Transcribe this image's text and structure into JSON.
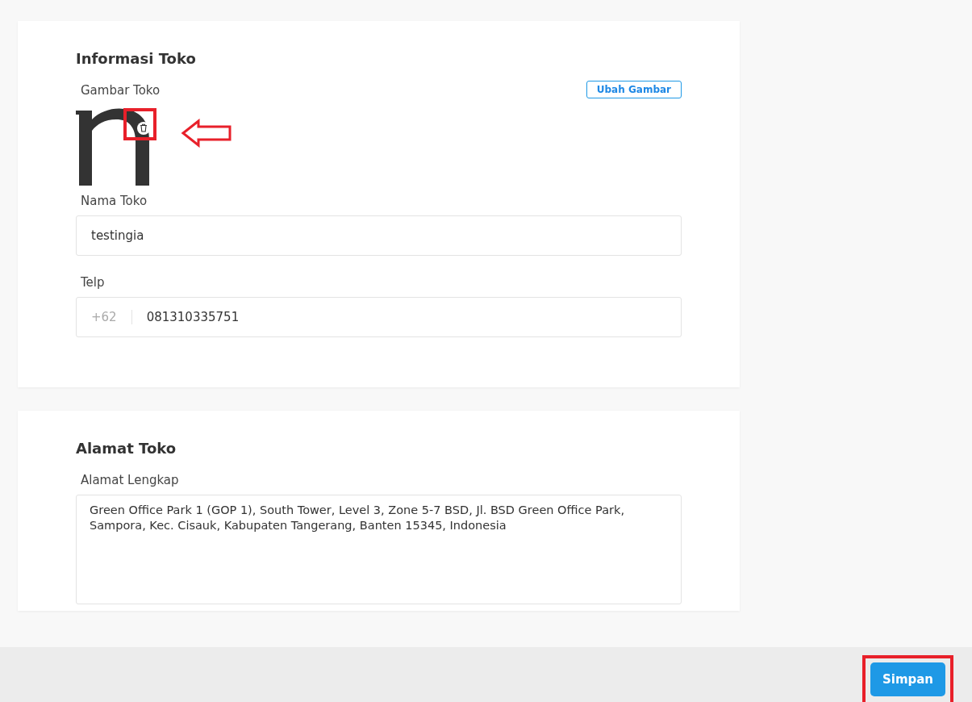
{
  "store_info": {
    "title": "Informasi Toko",
    "image_label": "Gambar Toko",
    "change_image_button": "Ubah Gambar",
    "name_label": "Nama Toko",
    "name_value": "testingia",
    "phone_label": "Telp",
    "phone_prefix": "+62",
    "phone_value": "081310335751"
  },
  "store_address": {
    "title": "Alamat Toko",
    "address_label": "Alamat Lengkap",
    "address_value": "Green Office Park 1 (GOP 1), South Tower, Level 3, Zone 5-7 BSD, Jl. BSD Green Office Park, Sampora, Kec. Cisauk, Kabupaten Tangerang, Banten 15345, Indonesia"
  },
  "footer": {
    "save_button": "Simpan"
  }
}
